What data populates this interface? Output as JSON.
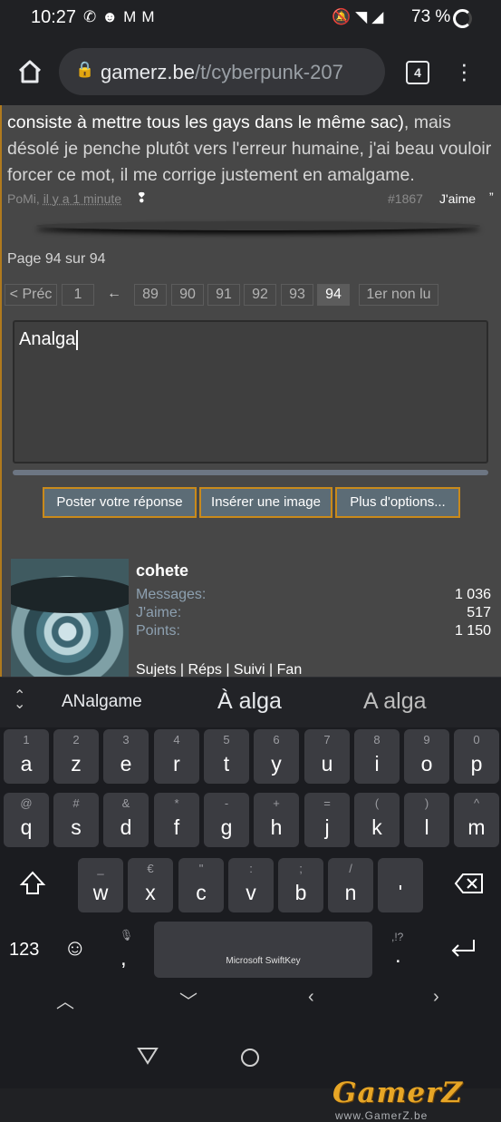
{
  "status": {
    "time": "10:27",
    "battery": "73 %",
    "app_icons": [
      "whatsapp-icon",
      "reddit-icon",
      "gmail-icon",
      "gmail-icon"
    ],
    "sys_icons": [
      "bell-off-icon",
      "wifi-icon",
      "signal-icon"
    ]
  },
  "browser": {
    "url_host": "gamerz.be",
    "url_path": "/t/cyberpunk-207",
    "tab_count": "4"
  },
  "post": {
    "text_line1_hi": "consiste à mettre tous les gays dans le même sac)",
    "text_line1_rest": ", mais",
    "text_rest": "désolé je penche plutôt vers l'erreur humaine, j'ai beau vouloir forcer ce mot, il me corrige justement en amalgame.",
    "author": "PoMi",
    "time": "il y a 1 minute",
    "number": "#1867",
    "like": "J'aime",
    "quote": "”"
  },
  "pagination": {
    "info": "Page 94 sur 94",
    "prev": "< Préc",
    "first": "1",
    "arrow": "←",
    "pages": [
      "89",
      "90",
      "91",
      "92",
      "93",
      "94"
    ],
    "current": "94",
    "first_unread": "1er non lu"
  },
  "reply": {
    "text": "Analga",
    "buttons": [
      "Poster votre réponse",
      "Insérer une image",
      "Plus d'options..."
    ]
  },
  "user": {
    "name": "cohete",
    "stats": [
      {
        "label": "Messages:",
        "value": "1 036"
      },
      {
        "label": "J'aime:",
        "value": "517"
      },
      {
        "label": "Points:",
        "value": "1 150"
      }
    ],
    "links": "Sujets | Réps | Suivi | Fan"
  },
  "keyboard": {
    "suggestions": [
      "ANalgame",
      "À alga",
      "A alga"
    ],
    "row1": [
      {
        "c": "a",
        "h": "1"
      },
      {
        "c": "z",
        "h": "2"
      },
      {
        "c": "e",
        "h": "3"
      },
      {
        "c": "r",
        "h": "4"
      },
      {
        "c": "t",
        "h": "5"
      },
      {
        "c": "y",
        "h": "6"
      },
      {
        "c": "u",
        "h": "7"
      },
      {
        "c": "i",
        "h": "8"
      },
      {
        "c": "o",
        "h": "9"
      },
      {
        "c": "p",
        "h": "0"
      }
    ],
    "row2": [
      {
        "c": "q",
        "h": "@"
      },
      {
        "c": "s",
        "h": "#"
      },
      {
        "c": "d",
        "h": "&"
      },
      {
        "c": "f",
        "h": "*"
      },
      {
        "c": "g",
        "h": "-"
      },
      {
        "c": "h",
        "h": "+"
      },
      {
        "c": "j",
        "h": "="
      },
      {
        "c": "k",
        "h": "("
      },
      {
        "c": "l",
        "h": ")"
      },
      {
        "c": "m",
        "h": "^"
      }
    ],
    "row3": [
      {
        "c": "w",
        "h": "_"
      },
      {
        "c": "x",
        "h": "€"
      },
      {
        "c": "c",
        "h": "\""
      },
      {
        "c": "v",
        "h": ":"
      },
      {
        "c": "b",
        "h": ";"
      },
      {
        "c": "n",
        "h": "/"
      },
      {
        "c": "'",
        "h": ""
      }
    ],
    "num_label": "123",
    "comma": ",",
    "period": ".",
    "period_hint": ",!?",
    "space_label": "Microsoft SwiftKey"
  },
  "watermark": {
    "logo": "GamerZ",
    "url": "www.GamerZ.be"
  }
}
